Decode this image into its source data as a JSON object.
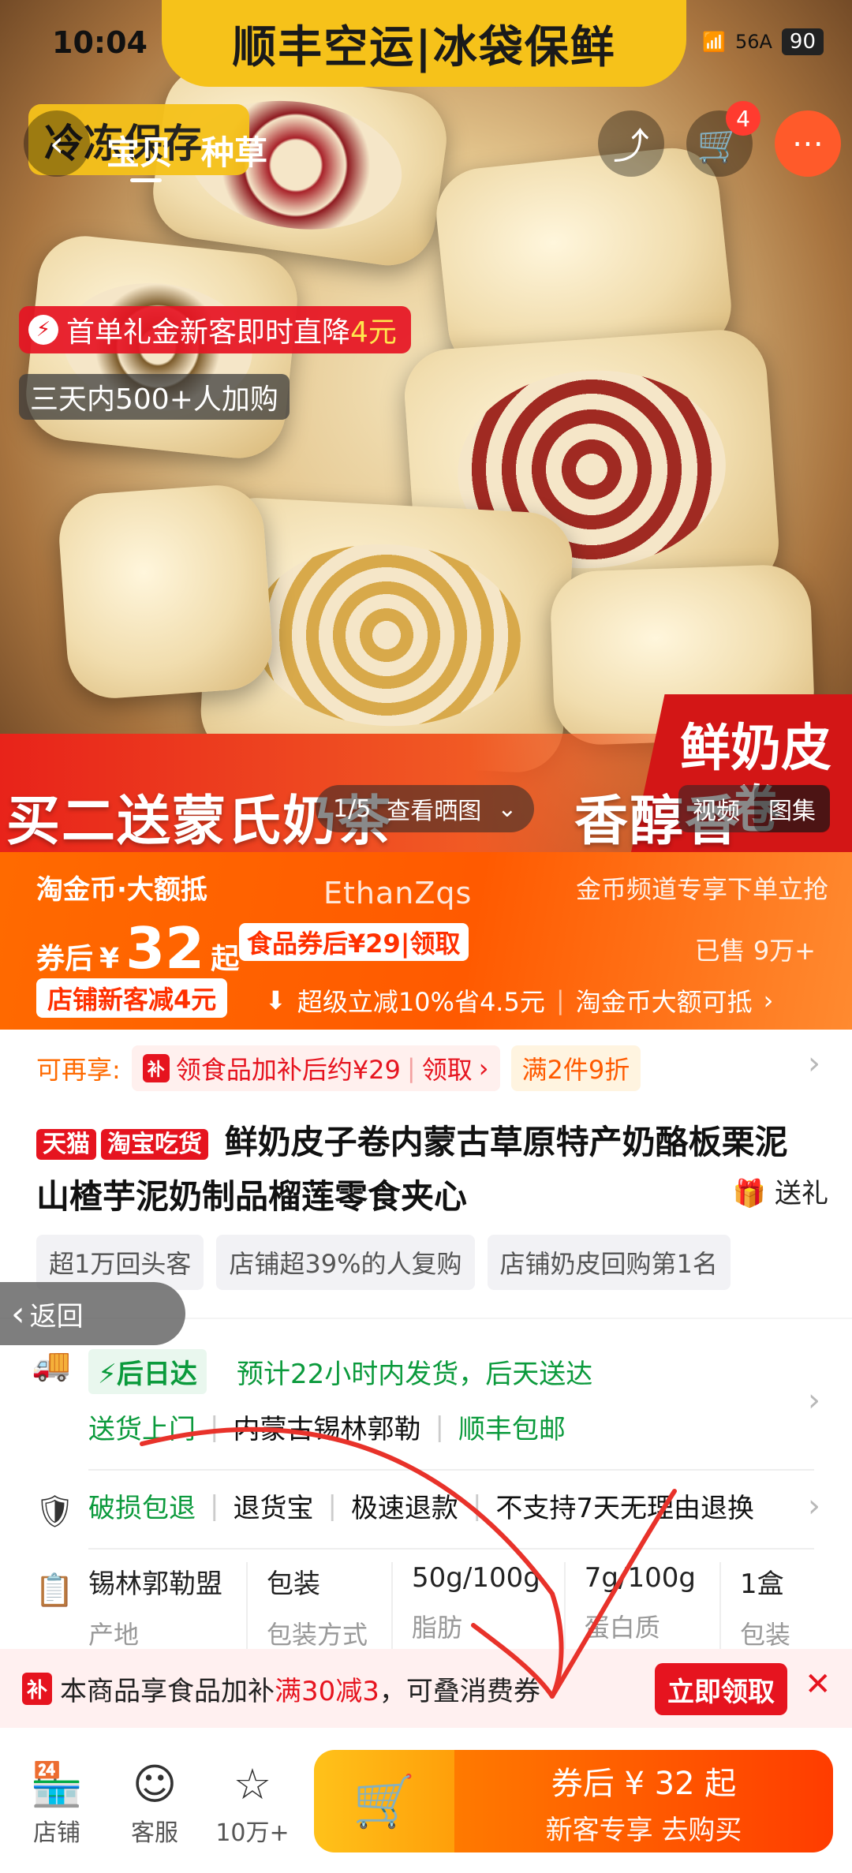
{
  "status": {
    "time": "10:04",
    "network": "56A",
    "battery": "90"
  },
  "banner_top": "顺丰空运|冰袋保鲜",
  "cold_tag": "冷冻保存",
  "nav": {
    "tabs": [
      "宝贝",
      "种草"
    ],
    "cart_count": "4"
  },
  "hero": {
    "gift_chip": {
      "text": "首单礼金新客即时直降",
      "amount": "4元"
    },
    "buy_chip": "三天内500+人加购",
    "promo": "买二送蒙氏奶茶",
    "promo_tail": "香醇香",
    "fresh_text": "鲜奶皮卷",
    "counter": "1/5",
    "view_photos": "查看晒图",
    "media_tabs": [
      "视频",
      "图集"
    ]
  },
  "price": {
    "coin_label": "淘金币·大额抵",
    "after_label": "券后",
    "currency": "¥",
    "amount": "32",
    "from": "起",
    "food_coupon": "食品券后¥29|领取",
    "watermark": "EthanZqs",
    "coin_channel": "金币频道专享下单立抢",
    "sold": "已售 9万+",
    "shop_new": "店铺新客减4元",
    "super_reduce": "超级立减10%省4.5元",
    "coin_deduct": "淘金币大额可抵"
  },
  "info": {
    "also_label": "可再享:",
    "subsidy_chip": "领食品加补后约¥29",
    "subsidy_claim": "领取",
    "discount_chip": "满2件9折",
    "tag_tmall": "天猫",
    "tag_taobao": "淘宝吃货",
    "title": "鲜奶皮子卷内蒙古草原特产奶酪板栗泥山楂芋泥奶制品榴莲零食夹心",
    "gift": "送礼",
    "pills": [
      "超1万回头客",
      "店铺超39%的人复购",
      "店铺奶皮回购第1名"
    ]
  },
  "back": "返回",
  "delivery": {
    "fast_tag": "后日达",
    "eta": "预计22小时内发货，后天送达",
    "door": "送货上门",
    "origin": "内蒙古锡林郭勒",
    "shipping": "顺丰包邮",
    "guarantees": [
      "破损包退",
      "退货宝",
      "极速退款",
      "不支持7天无理由退换"
    ],
    "specs": [
      {
        "value": "锡林郭勒盟",
        "key": "产地"
      },
      {
        "value": "包装",
        "key": "包装方式"
      },
      {
        "value": "50g/100g",
        "key": "脂肪"
      },
      {
        "value": "7g/100g",
        "key": "蛋白质"
      },
      {
        "value": "1盒",
        "key": "包装"
      }
    ]
  },
  "subsidy_bar": {
    "icon": "补",
    "prefix": "本商品享食品加补",
    "highlight": "满30减3",
    "suffix": "，可叠消费券",
    "claim": "立即领取"
  },
  "bottom": {
    "shop": "店铺",
    "service": "客服",
    "fav": "10万+",
    "buy_line1": "券后 ¥ 32 起",
    "buy_line2": "新客专享 去购买"
  },
  "colors": {
    "accent": "#ff5a00",
    "brand_red": "#e6141f",
    "green": "#0b9a3c",
    "banner_yellow": "#f6c21a"
  }
}
